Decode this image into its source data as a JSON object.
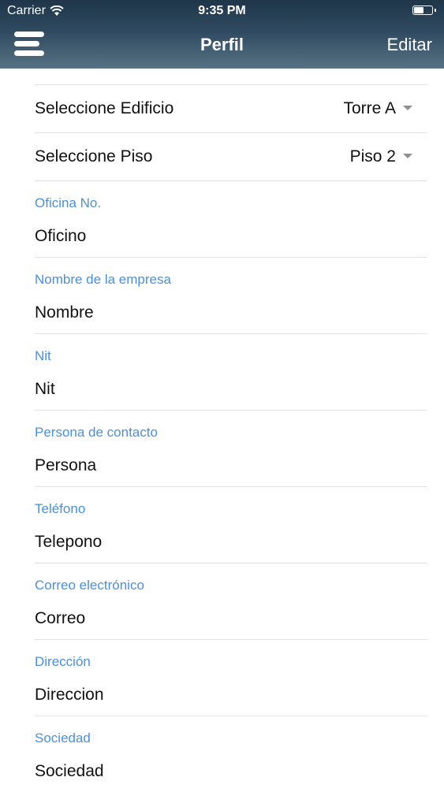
{
  "status_bar": {
    "carrier": "Carrier",
    "time": "9:35 PM",
    "battery_level": 0.5
  },
  "nav": {
    "title": "Perfil",
    "edit_label": "Editar",
    "menu_icon": "hamburger-icon"
  },
  "selects": [
    {
      "label": "Seleccione Edificio",
      "value": "Torre A"
    },
    {
      "label": "Seleccione Piso",
      "value": "Piso 2"
    }
  ],
  "fields": [
    {
      "label": "Oficina No.",
      "value": "Oficino"
    },
    {
      "label": "Nombre de la empresa",
      "value": "Nombre"
    },
    {
      "label": "Nit",
      "value": "Nit"
    },
    {
      "label": "Persona de contacto",
      "value": "Persona"
    },
    {
      "label": "Teléfono",
      "value": "Telepono"
    },
    {
      "label": "Correo electrónico",
      "value": "Correo"
    },
    {
      "label": "Dirección",
      "value": "Direccion"
    },
    {
      "label": "Sociedad",
      "value": "Sociedad"
    }
  ],
  "colors": {
    "header_top": "#1f3649",
    "header_bottom": "#587284",
    "field_label": "#4a90d9",
    "separator": "#e2e2e2"
  }
}
